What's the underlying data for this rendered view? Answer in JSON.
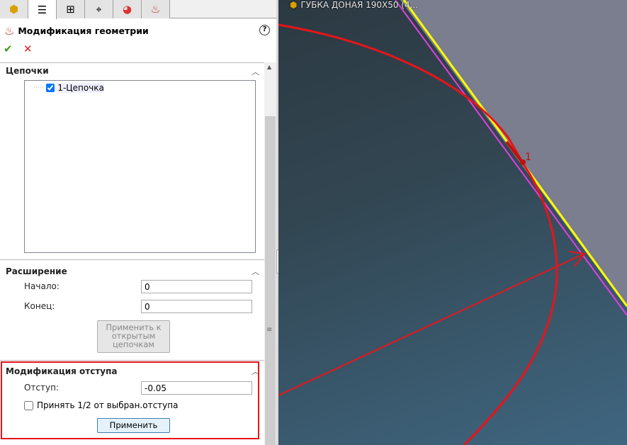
{
  "tabs": [
    "part-icon",
    "property-manager-icon",
    "config-icon",
    "crosshair-icon",
    "appearance-icon",
    "cam-icon"
  ],
  "title": "Модификация геометрии",
  "help": "?",
  "ok": "✔",
  "cancel": "✕",
  "chains": {
    "header": "Цепочки",
    "items": [
      {
        "label": "1-Цепочка",
        "checked": true
      }
    ]
  },
  "extension": {
    "header": "Расширение",
    "start_label": "Начало:",
    "start_value": "0",
    "end_label": "Конец:",
    "end_value": "0",
    "apply_open": "Применить к открытым цепочкам"
  },
  "offset": {
    "header": "Модификация отступа",
    "offset_label": "Отступ:",
    "offset_value": "-0.05",
    "half_label": "Принять 1/2 от выбран.отступа",
    "half_checked": false,
    "apply": "Применить"
  },
  "viewport": {
    "tree_item": "ГУБКА ДОНАЯ 190X50 (4...",
    "marker": "1"
  },
  "colors": {
    "highlight": "#e8141a",
    "yellow": "#ffff00",
    "magenta": "#e040e0"
  }
}
